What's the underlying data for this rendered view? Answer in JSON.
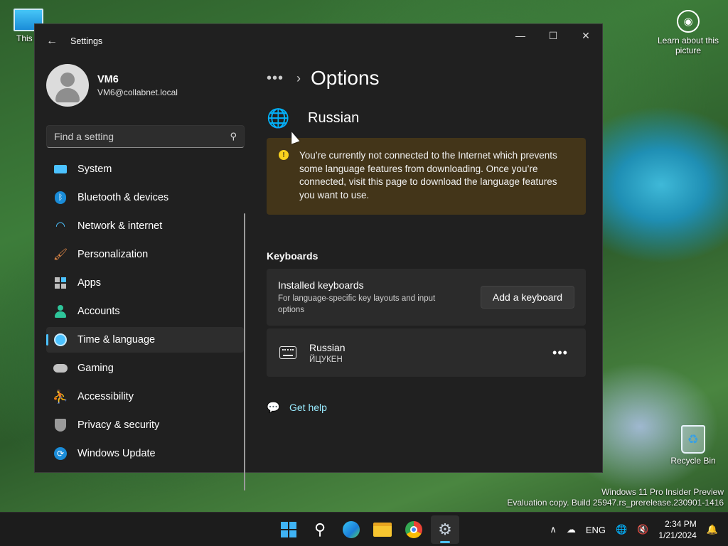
{
  "desktop": {
    "this_pc_label": "This P",
    "recycle_bin_label": "Recycle Bin",
    "learn_label": "Learn about this picture",
    "watermark_line1": "Windows 11 Pro Insider Preview",
    "watermark_line2": "Evaluation copy. Build 25947.rs_prerelease.230901-1416"
  },
  "window": {
    "title": "Settings",
    "minimize": "—",
    "maximize": "☐",
    "close": "✕"
  },
  "profile": {
    "name": "VM6",
    "email": "VM6@collabnet.local"
  },
  "search": {
    "placeholder": "Find a setting"
  },
  "sidebar": {
    "items": [
      {
        "label": "System",
        "icon": "system-icon",
        "color": "#4cc2ff"
      },
      {
        "label": "Bluetooth & devices",
        "icon": "bluetooth-icon",
        "color": "#1a8cd8"
      },
      {
        "label": "Network & internet",
        "icon": "wifi-icon",
        "color": "#4cc2ff"
      },
      {
        "label": "Personalization",
        "icon": "brush-icon",
        "color": "#e88c48"
      },
      {
        "label": "Apps",
        "icon": "apps-icon",
        "color": "#c2c2c2"
      },
      {
        "label": "Accounts",
        "icon": "accounts-icon",
        "color": "#2ec59a"
      },
      {
        "label": "Time & language",
        "icon": "time-language-icon",
        "color": "#4cc2ff",
        "active": true
      },
      {
        "label": "Gaming",
        "icon": "gaming-icon",
        "color": "#c2c2c2"
      },
      {
        "label": "Accessibility",
        "icon": "accessibility-icon",
        "color": "#4cc2ff"
      },
      {
        "label": "Privacy & security",
        "icon": "shield-icon",
        "color": "#9a9a9a"
      },
      {
        "label": "Windows Update",
        "icon": "update-icon",
        "color": "#1a8cd8"
      }
    ]
  },
  "main": {
    "breadcrumb_more": "•••",
    "page_title": "Options",
    "language_name": "Russian",
    "warning": "You’re currently not connected to the Internet which prevents some language features from downloading. Once you’re connected, visit this page to download the language features you want to use.",
    "keyboards_section": "Keyboards",
    "installed_title": "Installed keyboards",
    "installed_sub": "For language-specific key layouts and input options",
    "add_keyboard": "Add a keyboard",
    "keyboard_name": "Russian",
    "keyboard_layout": "ЙЦУКЕН",
    "keyboard_more": "•••",
    "get_help": "Get help"
  },
  "taskbar": {
    "language": "ENG",
    "time": "2:34 PM",
    "date": "1/21/2024",
    "accent": "#4cc2ff"
  }
}
